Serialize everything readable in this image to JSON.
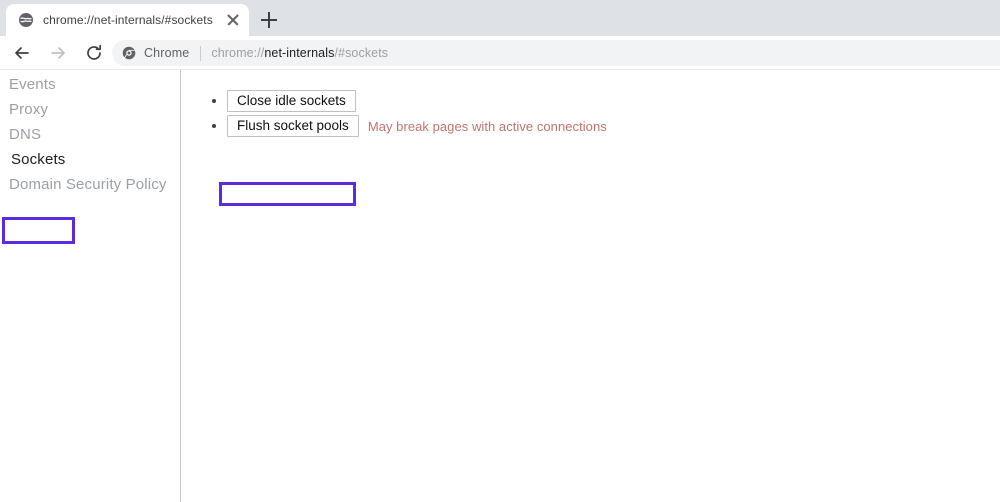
{
  "window": {
    "tab": {
      "favicon": "globe-icon",
      "title": "chrome://net-internals/#sockets",
      "close_label": "close-icon"
    },
    "new_tab_label": "+",
    "toolbar": {
      "back_label": "back-arrow-icon",
      "forward_label": "forward-arrow-icon",
      "reload_label": "reload-icon"
    },
    "omnibox": {
      "badge_icon": "chrome-logo-icon",
      "badge_text": "Chrome",
      "url_prefix": "chrome://",
      "url_host": "net-internals",
      "url_suffix": "/#sockets"
    }
  },
  "sidebar": {
    "items": [
      {
        "label": "Events",
        "active": false
      },
      {
        "label": "Proxy",
        "active": false
      },
      {
        "label": "DNS",
        "active": false
      },
      {
        "label": "Sockets",
        "active": true
      },
      {
        "label": "Domain Security Policy",
        "active": false
      }
    ]
  },
  "main": {
    "actions": [
      {
        "label": "Close idle sockets",
        "note": ""
      },
      {
        "label": "Flush socket pools",
        "note": "May break pages with active connections"
      }
    ]
  },
  "annotations": {
    "color": "#5b2be0",
    "targets": [
      "sockets-nav-item",
      "flush-socket-pools-button"
    ]
  },
  "colors": {
    "accent_highlight": "#5b2be0",
    "warning_text": "#c2736f",
    "tabstrip_bg": "#dee1e6",
    "omnibox_bg": "#f1f3f4",
    "muted_text": "#9aa0a6"
  }
}
